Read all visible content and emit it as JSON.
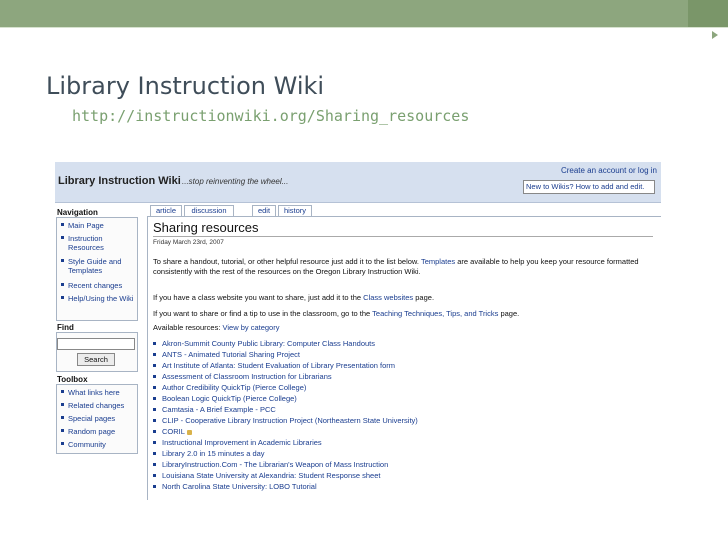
{
  "slide": {
    "title": "Library Instruction Wiki",
    "url": "http://instructionwiki.org/Sharing_resources",
    "accent_color": "#8da67e"
  },
  "wiki": {
    "logo": "Library Instruction Wiki",
    "tagline": "...stop reinventing the wheel...",
    "account_link": "Create an account or log in",
    "new_to_wikis": "New to Wikis? How to add and edit.",
    "sidebar": {
      "navigation_title": "Navigation",
      "navigation_items": [
        "Main Page",
        "Instruction Resources",
        "Style Guide and Templates",
        "Recent changes",
        "Help/Using the Wiki"
      ],
      "find_title": "Find",
      "search_button": "Search",
      "toolbox_title": "Toolbox",
      "toolbox_items": [
        "What links here",
        "Related changes",
        "Special pages",
        "Random page",
        "Community"
      ]
    },
    "tabs": [
      "article",
      "discussion",
      "edit",
      "history"
    ],
    "page_title": "Sharing resources",
    "date": "Friday March 23rd, 2007",
    "intro": {
      "before": "To share a handout, tutorial, or other helpful resource just add it to the list below.",
      "link": "Templates",
      "after": "are available to help you keep your resource formatted consistently with the rest of the resources on the Oregon Library Instruction Wiki."
    },
    "class_sites": {
      "before": "If you have a class website you want to share, just add it to the",
      "link": "Class websites",
      "after": "page."
    },
    "tips": {
      "before": "If you want to share or find a tip to use in the classroom, go to the",
      "link": "Teaching Techniques, Tips, and Tricks",
      "after": "page."
    },
    "available": {
      "label": "Available resources:",
      "link": "View by category"
    },
    "resources": [
      "Akron-Summit County Public Library: Computer Class Handouts",
      "ANTS - Animated Tutorial Sharing Project",
      "Art Institute of Atlanta: Student Evaluation of Library Presentation form",
      "Assessment of Classroom Instruction for Librarians",
      "Author Credibility QuickTip (Pierce College)",
      "Boolean Logic QuickTip (Pierce College)",
      "Camtasia - A Brief Example - PCC",
      "CLIP - Cooperative Library Instruction Project (Northeastern State University)",
      "CORIL",
      "Instructional Improvement in Academic Libraries",
      "Library 2.0 in 15 minutes a day",
      "LibraryInstruction.Com - The Librarian's Weapon of Mass Instruction",
      "Louisiana State University at Alexandria: Student Response sheet",
      "North Carolina State University: LOBO Tutorial"
    ]
  }
}
